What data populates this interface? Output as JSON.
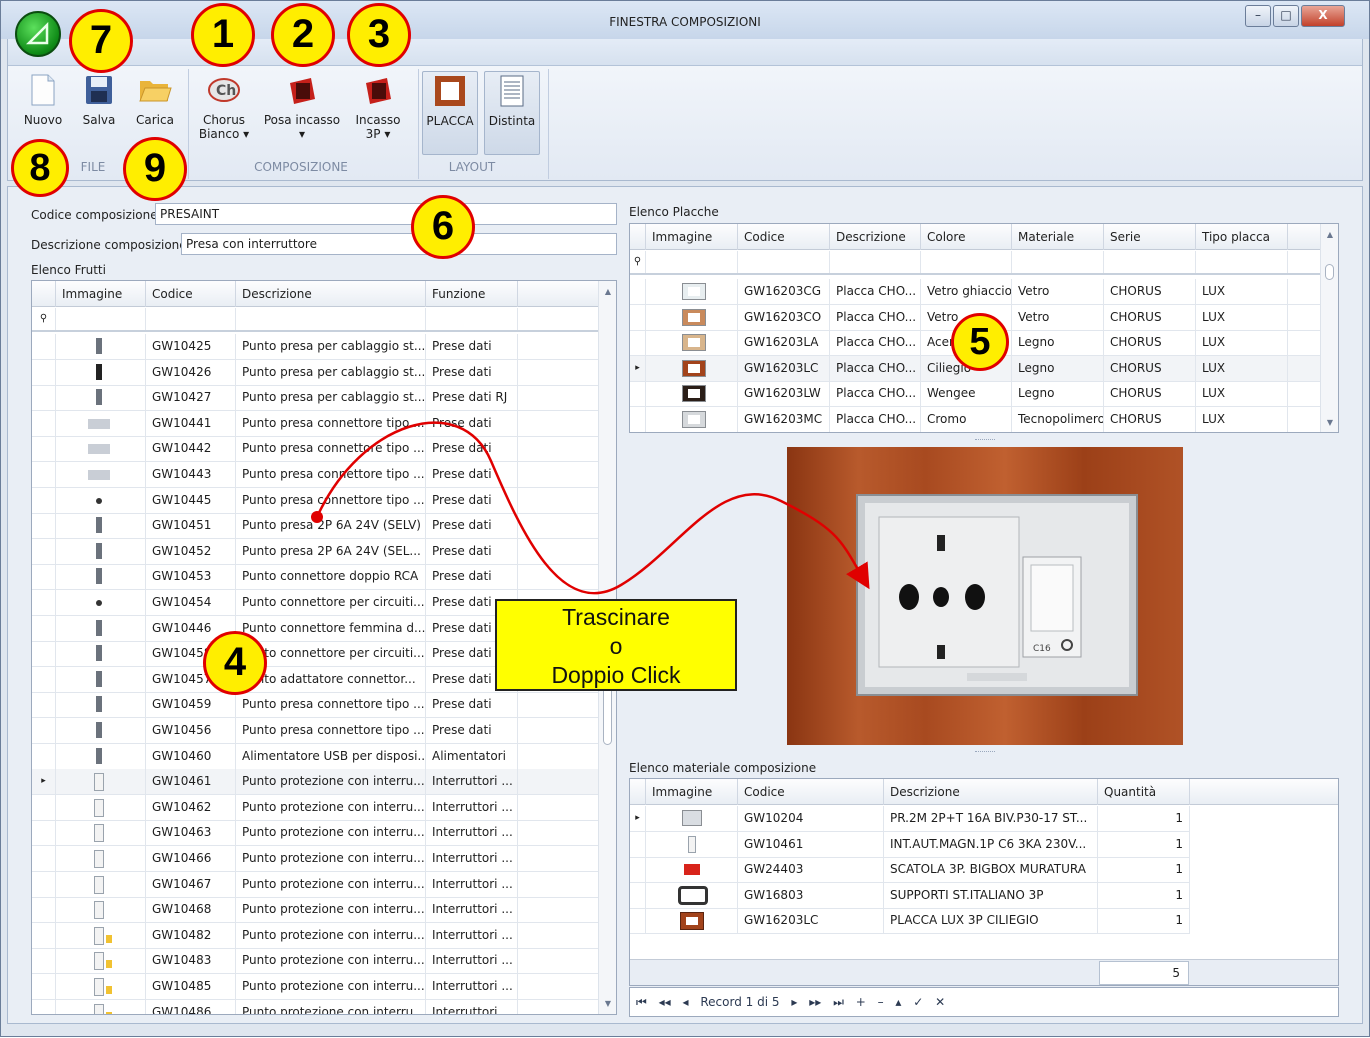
{
  "window": {
    "title": "FINESTRA COMPOSIZIONI",
    "controls": {
      "minimize": "–",
      "maximize": "□",
      "close": "X"
    }
  },
  "ribbon": {
    "buttons": {
      "nuovo": "Nuovo",
      "salva": "Salva",
      "carica": "Carica",
      "chorus_line1": "Chorus",
      "chorus_line2": "Bianco ▾",
      "posa_line1": "Posa incasso",
      "posa_line2": "▾",
      "incasso_line1": "Incasso",
      "incasso_line2": "3P ▾",
      "placca": "PLACCA",
      "distinta": "Distinta"
    },
    "groups": {
      "file": "FILE",
      "composizione": "COMPOSIZIONE",
      "layout": "LAYOUT"
    }
  },
  "badges": {
    "b1": "1",
    "b2": "2",
    "b3": "3",
    "b4": "4",
    "b5": "5",
    "b6": "6",
    "b7": "7",
    "b8": "8",
    "b9": "9"
  },
  "form": {
    "codice_label": "Codice composizione",
    "codice_value": "PRESAINT",
    "descrizione_label": "Descrizione composizione",
    "descrizione_value": "Presa con interruttore"
  },
  "frutti": {
    "title": "Elenco Frutti",
    "columns": {
      "immagine": "Immagine",
      "codice": "Codice",
      "descrizione": "Descrizione",
      "funzione": "Funzione"
    },
    "rows": [
      {
        "codice": "GW10425",
        "descrizione": "Punto presa per cablaggio st...",
        "funzione": "Prese dati"
      },
      {
        "codice": "GW10426",
        "descrizione": "Punto presa per cablaggio st...",
        "funzione": "Prese dati"
      },
      {
        "codice": "GW10427",
        "descrizione": "Punto presa per cablaggio st...",
        "funzione": "Prese dati RJ"
      },
      {
        "codice": "GW10441",
        "descrizione": "Punto presa connettore tipo ...",
        "funzione": "Prese dati"
      },
      {
        "codice": "GW10442",
        "descrizione": "Punto presa connettore tipo ...",
        "funzione": "Prese dati"
      },
      {
        "codice": "GW10443",
        "descrizione": "Punto presa connettore tipo ...",
        "funzione": "Prese dati"
      },
      {
        "codice": "GW10445",
        "descrizione": "Punto presa connettore tipo ...",
        "funzione": "Prese dati"
      },
      {
        "codice": "GW10451",
        "descrizione": "Punto presa 2P 6A 24V (SELV)",
        "funzione": "Prese dati"
      },
      {
        "codice": "GW10452",
        "descrizione": "Punto presa 2P 6A 24V (SEL...",
        "funzione": "Prese dati"
      },
      {
        "codice": "GW10453",
        "descrizione": "Punto connettore doppio RCA",
        "funzione": "Prese dati"
      },
      {
        "codice": "GW10454",
        "descrizione": "Punto connettore per circuiti...",
        "funzione": "Prese dati"
      },
      {
        "codice": "GW10446",
        "descrizione": "Punto connettore femmina d...",
        "funzione": "Prese dati"
      },
      {
        "codice": "GW10458",
        "descrizione": "Punto connettore per circuiti...",
        "funzione": "Prese dati"
      },
      {
        "codice": "GW10457",
        "descrizione": "Punto adattatore connettor...",
        "funzione": "Prese dati"
      },
      {
        "codice": "GW10459",
        "descrizione": "Punto presa connettore tipo ...",
        "funzione": "Prese dati"
      },
      {
        "codice": "GW10456",
        "descrizione": "Punto presa connettore tipo ...",
        "funzione": "Prese dati"
      },
      {
        "codice": "GW10460",
        "descrizione": "Alimentatore USB per disposi...",
        "funzione": "Alimentatori"
      },
      {
        "codice": "GW10461",
        "descrizione": "Punto protezione con interru...",
        "funzione": "Interruttori ..."
      },
      {
        "codice": "GW10462",
        "descrizione": "Punto protezione con interru...",
        "funzione": "Interruttori ..."
      },
      {
        "codice": "GW10463",
        "descrizione": "Punto protezione con interru...",
        "funzione": "Interruttori ..."
      },
      {
        "codice": "GW10466",
        "descrizione": "Punto protezione con interru...",
        "funzione": "Interruttori ..."
      },
      {
        "codice": "GW10467",
        "descrizione": "Punto protezione con interru...",
        "funzione": "Interruttori ..."
      },
      {
        "codice": "GW10468",
        "descrizione": "Punto protezione con interru...",
        "funzione": "Interruttori ..."
      },
      {
        "codice": "GW10482",
        "descrizione": "Punto protezione con interru...",
        "funzione": "Interruttori ..."
      },
      {
        "codice": "GW10483",
        "descrizione": "Punto protezione con interru...",
        "funzione": "Interruttori ..."
      },
      {
        "codice": "GW10485",
        "descrizione": "Punto protezione con interru...",
        "funzione": "Interruttori ..."
      },
      {
        "codice": "GW10486",
        "descrizione": "Punto protezione con interru...",
        "funzione": "Interruttori ..."
      }
    ]
  },
  "placche": {
    "title": "Elenco Placche",
    "columns": {
      "immagine": "Immagine",
      "codice": "Codice",
      "descrizione": "Descrizione",
      "colore": "Colore",
      "materiale": "Materiale",
      "serie": "Serie",
      "tipo": "Tipo placca"
    },
    "rows": [
      {
        "codice": "GW16203CG",
        "descrizione": "Placca CHO...",
        "colore": "Vetro ghiaccio",
        "materiale": "Vetro",
        "serie": "CHORUS",
        "tipo": "LUX",
        "swatch": "#e8eef0"
      },
      {
        "codice": "GW16203CO",
        "descrizione": "Placca CHO...",
        "colore": "Vetro ...",
        "materiale": "Vetro",
        "serie": "CHORUS",
        "tipo": "LUX",
        "swatch": "#c98a5c"
      },
      {
        "codice": "GW16203LA",
        "descrizione": "Placca CHO...",
        "colore": "Acero",
        "materiale": "Legno",
        "serie": "CHORUS",
        "tipo": "LUX",
        "swatch": "#d8b58c"
      },
      {
        "codice": "GW16203LC",
        "descrizione": "Placca CHO...",
        "colore": "Ciliegio",
        "materiale": "Legno",
        "serie": "CHORUS",
        "tipo": "LUX",
        "swatch": "#a2431b"
      },
      {
        "codice": "GW16203LW",
        "descrizione": "Placca CHO...",
        "colore": "Wengee",
        "materiale": "Legno",
        "serie": "CHORUS",
        "tipo": "LUX",
        "swatch": "#2a1e18"
      },
      {
        "codice": "GW16203MC",
        "descrizione": "Placca CHO...",
        "colore": "Cromo",
        "materiale": "Tecnopolimero",
        "serie": "CHORUS",
        "tipo": "LUX",
        "swatch": "#d6d9dc"
      }
    ]
  },
  "materiale": {
    "title": "Elenco materiale composizione",
    "columns": {
      "immagine": "Immagine",
      "codice": "Codice",
      "descrizione": "Descrizione",
      "quantita": "Quantità"
    },
    "rows": [
      {
        "codice": "GW10204",
        "descrizione": "PR.2M 2P+T 16A BIV.P30-17 ST...",
        "quantita": "1"
      },
      {
        "codice": "GW10461",
        "descrizione": "INT.AUT.MAGN.1P C6 3KA 230V...",
        "quantita": "1"
      },
      {
        "codice": "GW24403",
        "descrizione": "SCATOLA 3P. BIGBOX MURATURA",
        "quantita": "1"
      },
      {
        "codice": "GW16803",
        "descrizione": "SUPPORTI ST.ITALIANO 3P",
        "quantita": "1"
      },
      {
        "codice": "GW16203LC",
        "descrizione": "PLACCA LUX 3P CILIEGIO",
        "quantita": "1"
      }
    ],
    "total": "5"
  },
  "navigator": {
    "first": "⏮",
    "prev_page": "◂◂",
    "prev": "◂",
    "record": "Record 1 di 5",
    "next": "▸",
    "next_page": "▸▸",
    "last": "⏭",
    "add": "+",
    "remove": "–",
    "edit": "▴",
    "accept": "✓",
    "cancel": "✕"
  },
  "callout": {
    "line1": "Trascinare",
    "line2": "o",
    "line3": "Doppio Click"
  },
  "photo": {
    "breaker_label": "C16"
  },
  "colors": {
    "badge_fill": "#ffee00",
    "badge_border": "#e00000",
    "arrow": "#e00000",
    "callout": "#ffff00"
  }
}
